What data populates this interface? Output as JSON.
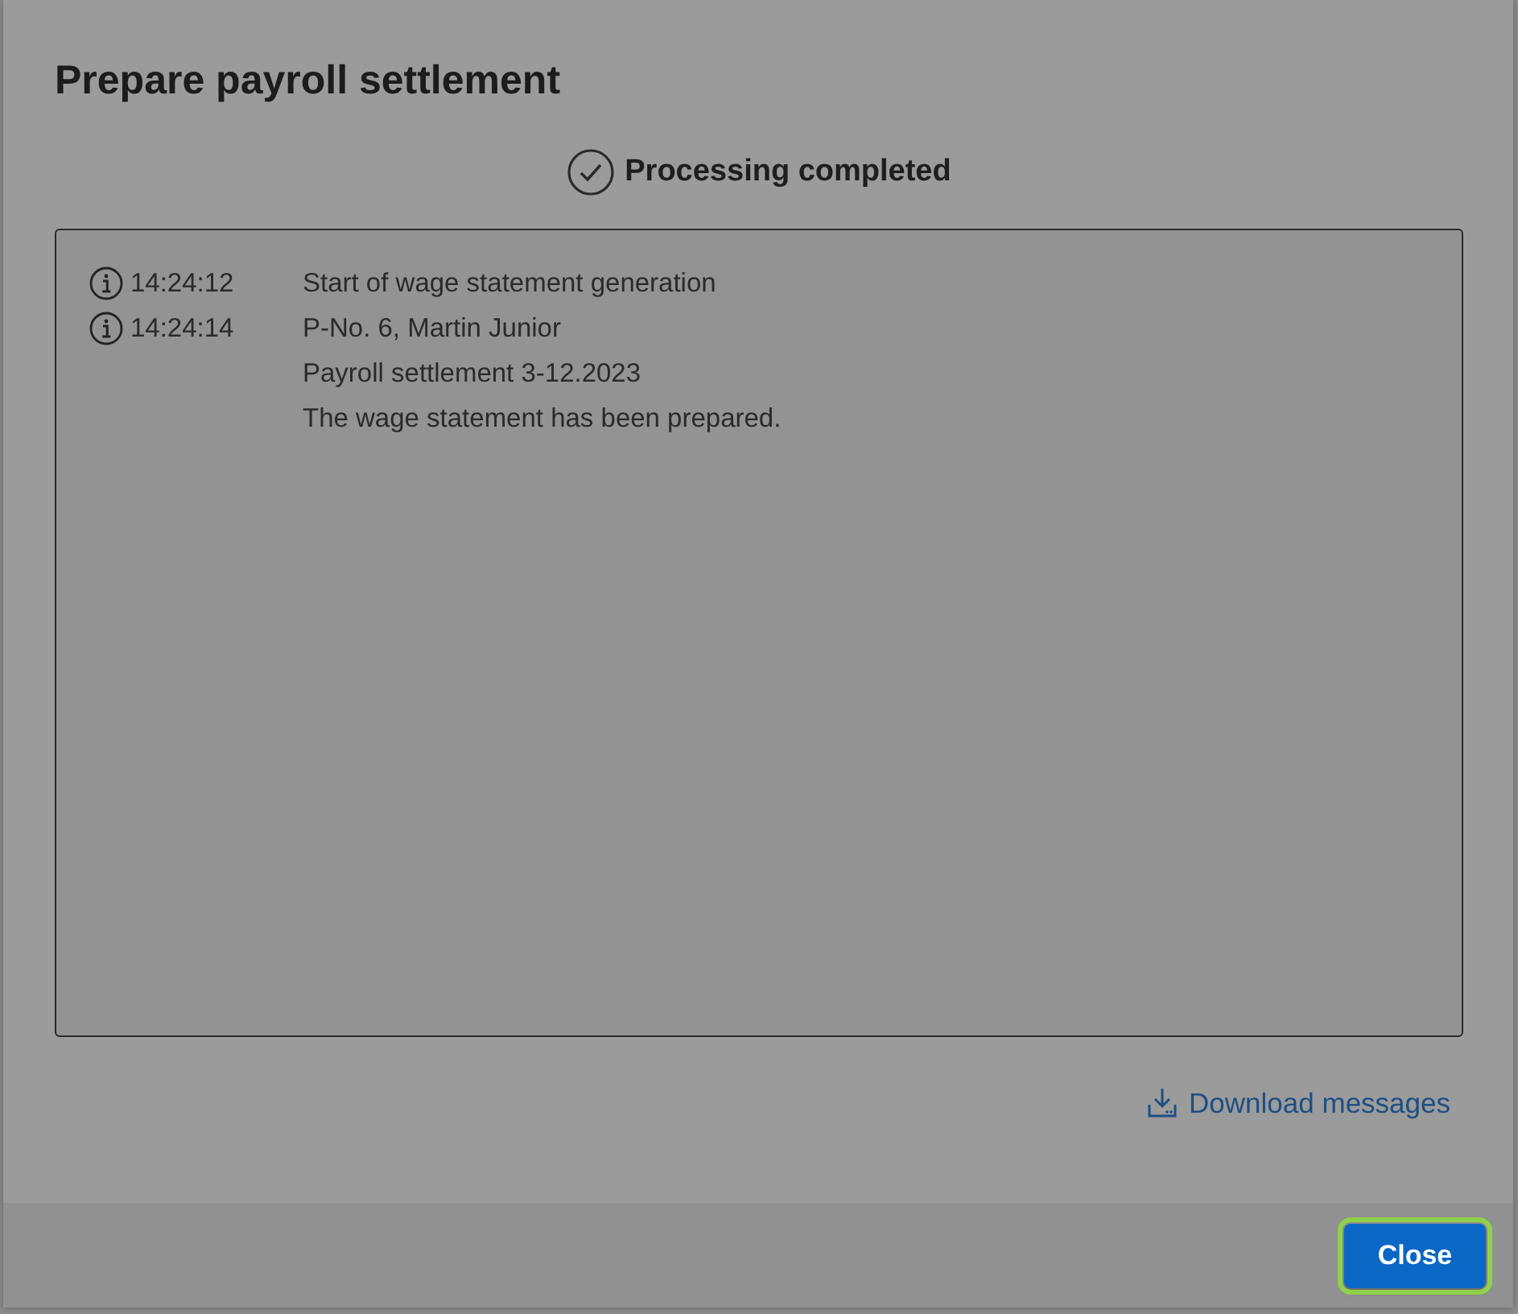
{
  "dialog": {
    "title": "Prepare payroll settlement",
    "status": {
      "kind": "completed",
      "text": "Processing completed"
    },
    "log": [
      {
        "kind": "info",
        "time": "14:24:12",
        "messages": [
          "Start of wage statement generation"
        ]
      },
      {
        "kind": "info",
        "time": "14:24:14",
        "messages": [
          "P-No. 6, Martin Junior",
          "Payroll settlement 3-12.2023",
          "The wage statement has been prepared."
        ]
      }
    ],
    "download_link": "Download messages",
    "buttons": [
      {
        "label": "Close",
        "focused": true
      }
    ]
  }
}
